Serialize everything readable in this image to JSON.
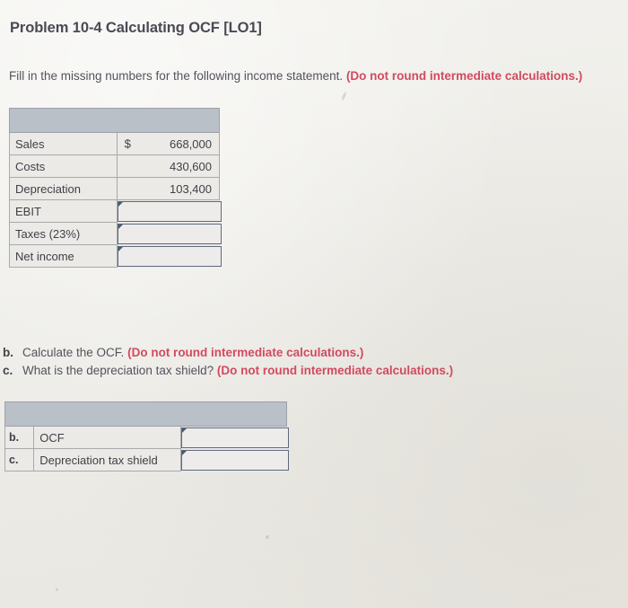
{
  "page": {
    "title": "Problem 10-4 Calculating OCF [LO1]",
    "background_color": "#efeeea",
    "text_color": "#53535d",
    "accent_red": "#d24a60",
    "header_bar_color": "#b9c0c7",
    "input_border_color": "#5d6a7d"
  },
  "instruction": {
    "text_plain": "Fill in the missing numbers for the following income statement.",
    "text_red": "(Do not round intermediate calculations.)"
  },
  "income_statement": {
    "header_label": "",
    "currency_symbol": "$",
    "rows": [
      {
        "label": "Sales",
        "currency": "$",
        "value": "668,000",
        "is_input": false
      },
      {
        "label": "Costs",
        "currency": "",
        "value": "430,600",
        "is_input": false
      },
      {
        "label": "Depreciation",
        "currency": "",
        "value": "103,400",
        "is_input": false
      },
      {
        "label": "EBIT",
        "currency": "",
        "value": "",
        "is_input": true
      },
      {
        "label": "Taxes (23%)",
        "currency": "",
        "value": "",
        "is_input": true
      },
      {
        "label": "Net income",
        "currency": "",
        "value": "",
        "is_input": true
      }
    ]
  },
  "parts": [
    {
      "letter": "b.",
      "text_plain": "Calculate the OCF.",
      "text_red": "(Do not round intermediate calculations.)"
    },
    {
      "letter": "c.",
      "text_plain": "What is the depreciation tax shield?",
      "text_red": "(Do not round intermediate calculations.)"
    }
  ],
  "answers_table": {
    "header_label": "",
    "rows": [
      {
        "letter": "b.",
        "label": "OCF",
        "value": "",
        "is_input": true
      },
      {
        "letter": "c.",
        "label": "Depreciation tax shield",
        "value": "",
        "is_input": true
      }
    ]
  }
}
